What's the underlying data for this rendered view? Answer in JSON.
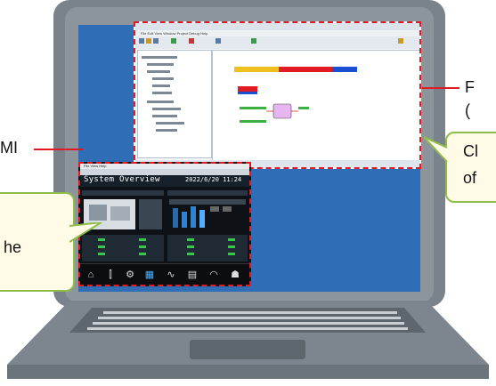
{
  "labels": {
    "hmi_label": "MI",
    "scada_label_line1": "F",
    "scada_label_line2": "(",
    "right_bubble_line1": "Cl",
    "right_bubble_line2": "of",
    "left_bubble_line1": "he"
  },
  "hmi": {
    "title": "System Overview",
    "clock": "2022/6/20 11:24",
    "menu": "File  View  Help",
    "nav_items": [
      "",
      "",
      "",
      "",
      "",
      "",
      "",
      ""
    ]
  },
  "scada": {
    "menu": "File  Edit  View  Window  Project  Debug  Help"
  },
  "colors": {
    "dashed_border": "#e01b24",
    "bubble_border": "#8fbd4a",
    "bubble_fill": "#fffbe6",
    "screen_blue": "#2f6eb6",
    "laptop_gray": "#7a838c"
  }
}
